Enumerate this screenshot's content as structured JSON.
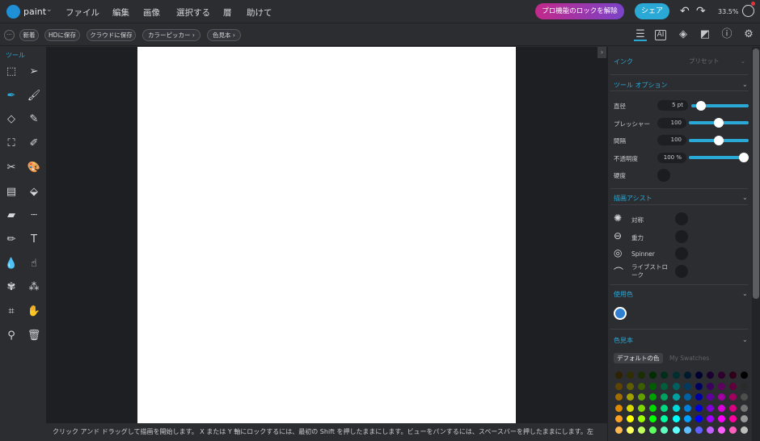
{
  "app": {
    "name": "paint",
    "caret": "⌄"
  },
  "menu": [
    "ファイル",
    "編集",
    "画像",
    "選択する",
    "層",
    "助けて"
  ],
  "header": {
    "unlock_label": "プロ機能のロックを解除",
    "share_label": "シェア",
    "zoom": "33.5%"
  },
  "toolbar2": {
    "buttons": [
      "新着",
      "HDに保存",
      "クラウドに保存",
      "カラーピッカー  ›",
      "色見本  ›"
    ]
  },
  "tools_label": "ツール",
  "tools": [
    {
      "name": "rect-select-icon",
      "glyph": "⬚"
    },
    {
      "name": "pointer-icon",
      "glyph": "➢"
    },
    {
      "name": "ink-pen-icon",
      "glyph": "✒"
    },
    {
      "name": "brush-icon",
      "glyph": "🖌"
    },
    {
      "name": "eraser-icon",
      "glyph": "◇"
    },
    {
      "name": "pencil-icon",
      "glyph": "✎"
    },
    {
      "name": "transform-icon",
      "glyph": "⛶"
    },
    {
      "name": "calligraphy-icon",
      "glyph": "✐"
    },
    {
      "name": "smudge-icon",
      "glyph": "✂"
    },
    {
      "name": "paint-bucket-icon",
      "glyph": "🎨"
    },
    {
      "name": "gradient-icon",
      "glyph": "▤"
    },
    {
      "name": "fill-icon",
      "glyph": "⬙"
    },
    {
      "name": "highlighter-icon",
      "glyph": "▰"
    },
    {
      "name": "dashed-line-icon",
      "glyph": "┄"
    },
    {
      "name": "stamp-icon",
      "glyph": "✏"
    },
    {
      "name": "text-icon",
      "glyph": "T"
    },
    {
      "name": "blur-drop-icon",
      "glyph": "💧"
    },
    {
      "name": "finger-icon",
      "glyph": "☝"
    },
    {
      "name": "clone-icon",
      "glyph": "✾"
    },
    {
      "name": "pattern-icon",
      "glyph": "⁂"
    },
    {
      "name": "crop-icon",
      "glyph": "⌗"
    },
    {
      "name": "hand-icon",
      "glyph": "✋"
    },
    {
      "name": "eyedropper-icon",
      "glyph": "⚲"
    },
    {
      "name": "trash-icon",
      "glyph": "🗑"
    }
  ],
  "status": "クリック アンド ドラッグして描画を開始します。 X または Y 軸にロックするには、最初の Shift を押したままにします。ビューをパンするには、スペースバーを押したままにします。左",
  "panel": {
    "ink_label": "インク",
    "preset_label": "プリセット",
    "tool_options_label": "ツール オプション",
    "options": [
      {
        "label": "直径",
        "value": "5",
        "unit": "pt",
        "level": 0.1
      },
      {
        "label": "プレッシャー",
        "value": "100",
        "unit": "",
        "level": 0.5
      },
      {
        "label": "間隔",
        "value": "100",
        "unit": "",
        "level": 0.5
      },
      {
        "label": "不透明度",
        "value": "100",
        "unit": "%",
        "level": 1.0
      }
    ],
    "hardness_label": "硬度",
    "assist_label": "描画アシスト",
    "assists": [
      "対称",
      "重力",
      "Spinner",
      "ライブストローク"
    ],
    "used_colors_label": "使用色",
    "used_color": "#2f7fd0",
    "swatches_label": "色見本",
    "swatch_tabs": [
      "デフォルトの色",
      "My Swatches"
    ]
  },
  "palette_rows": [
    [
      "#2e2200",
      "#2e2e00",
      "#1a2e00",
      "#002e00",
      "#002e1a",
      "#002e2e",
      "#001a2e",
      "#00002e",
      "#1a002e",
      "#2e002e",
      "#2e001a",
      "#000000"
    ],
    [
      "#5e4400",
      "#5e5e00",
      "#3a5e00",
      "#005e00",
      "#005e3a",
      "#005e5e",
      "#003a5e",
      "#00005e",
      "#3a005e",
      "#5e005e",
      "#5e003a",
      "#2a2a2a"
    ],
    [
      "#a06c00",
      "#a0a000",
      "#60a000",
      "#00a000",
      "#00a060",
      "#00a0a0",
      "#0060a0",
      "#0000a0",
      "#6000a0",
      "#a000a0",
      "#a00060",
      "#4d4d4d"
    ],
    [
      "#e08a00",
      "#d8d800",
      "#80d800",
      "#00d800",
      "#00d880",
      "#00d8d8",
      "#0080d8",
      "#0000d8",
      "#8000d8",
      "#d800d8",
      "#d80080",
      "#737373"
    ],
    [
      "#ffa020",
      "#ffff00",
      "#a0ff00",
      "#00ff00",
      "#00ffa0",
      "#00ffff",
      "#00a0ff",
      "#0000ff",
      "#a000ff",
      "#ff00ff",
      "#ff00a0",
      "#999999"
    ],
    [
      "#ffb850",
      "#ffff60",
      "#c0ff60",
      "#60ff60",
      "#60ffc0",
      "#60ffff",
      "#60c0ff",
      "#6060ff",
      "#c060ff",
      "#ff60ff",
      "#ff60c0",
      "#bdbdbd"
    ]
  ]
}
